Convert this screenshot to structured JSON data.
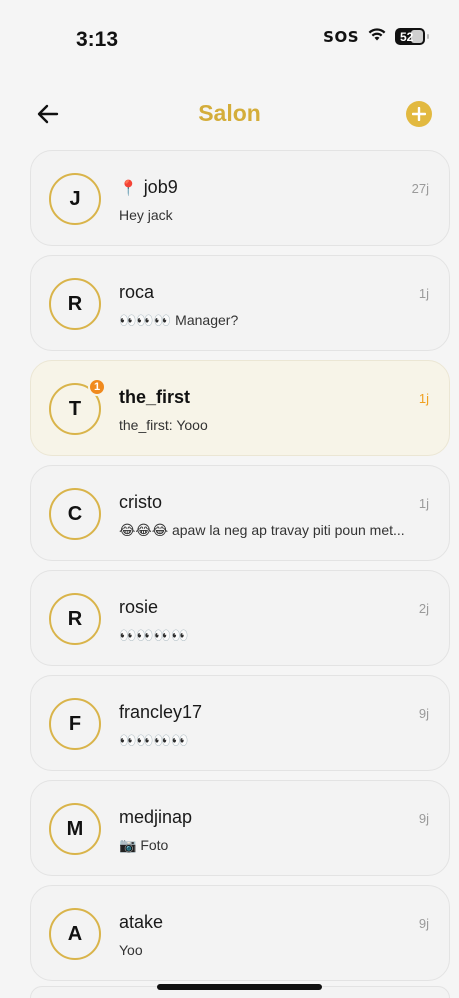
{
  "status": {
    "time": "3:13",
    "sos": "SOS",
    "battery": "52"
  },
  "header": {
    "title": "Salon",
    "back_icon": "arrow-left-icon",
    "add_icon": "plus-icon"
  },
  "colors": {
    "accent": "#d4ad3a",
    "badge": "#f08a1e"
  },
  "chats": [
    {
      "initial": "J",
      "name": "job9",
      "pin": "📍",
      "time": "27j",
      "preview": "Hey jack",
      "unread": false
    },
    {
      "initial": "R",
      "name": "roca",
      "time": "1j",
      "preview": "👀👀👀 Manager?",
      "unread": false
    },
    {
      "initial": "T",
      "name": "the_first",
      "time": "1j",
      "preview": "the_first: Yooo",
      "unread": true,
      "badge": "1"
    },
    {
      "initial": "C",
      "name": "cristo",
      "time": "1j",
      "preview": "😂😂😂 apaw la neg ap travay piti poun met...",
      "unread": false
    },
    {
      "initial": "R",
      "name": "rosie",
      "time": "2j",
      "preview": "👀👀👀👀",
      "unread": false
    },
    {
      "initial": "F",
      "name": "francley17",
      "time": "9j",
      "preview": "👀👀👀👀",
      "unread": false
    },
    {
      "initial": "M",
      "name": "medjinap",
      "time": "9j",
      "preview": "📷 Foto",
      "unread": false
    },
    {
      "initial": "A",
      "name": "atake",
      "time": "9j",
      "preview": "Yoo",
      "unread": false
    }
  ]
}
